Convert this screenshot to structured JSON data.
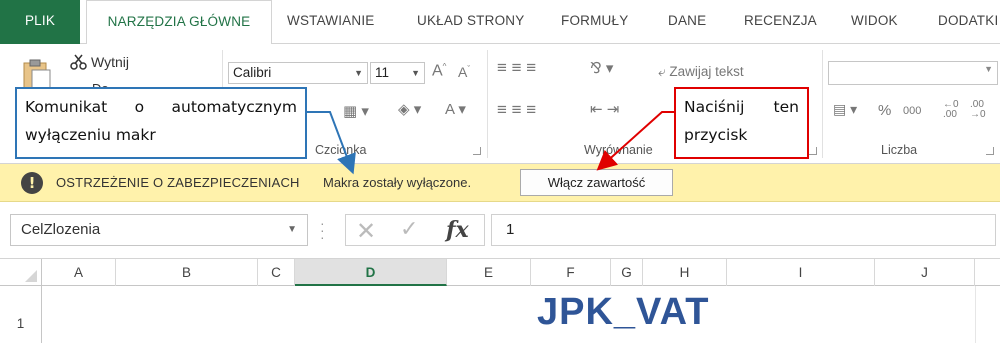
{
  "tabs": {
    "file": "PLIK",
    "home": "NARZĘDZIA GŁÓWNE",
    "insert": "WSTAWIANIE",
    "layout": "UKŁAD STRONY",
    "formulas": "FORMUŁY",
    "data": "DANE",
    "review": "RECENZJA",
    "view": "WIDOK",
    "developer": "DODATKI"
  },
  "ribbon": {
    "clipboard": {
      "cut_label": "Wytnij",
      "copy_label_partial": "Do..."
    },
    "font": {
      "name": "Calibri",
      "size": "11",
      "group_label": "Czcionka"
    },
    "alignment": {
      "wrap_label": "Zawijaj tekst",
      "group_label": "Wyrównanie"
    },
    "number": {
      "group_label": "Liczba",
      "percent": "%",
      "thousands": "000"
    }
  },
  "security_bar": {
    "title": "OSTRZEŻENIE O ZABEZPIECZENIACH",
    "message": "Makra zostały wyłączone.",
    "enable_button": "Włącz zawartość"
  },
  "formula_bar": {
    "name_box": "CelZlozenia",
    "fx": "fx",
    "value": "1"
  },
  "sheet": {
    "columns": [
      "A",
      "B",
      "C",
      "D",
      "E",
      "F",
      "G",
      "H",
      "I",
      "J"
    ],
    "selected_column": "D",
    "row_label": "1",
    "title_text": "JPK_VAT"
  },
  "callouts": {
    "blue_line1": "Komunikat o automatycznym",
    "blue_line2": "wyłączeniu makr",
    "red_line1": "Naciśnij ten",
    "red_line2": "przycisk"
  },
  "colors": {
    "excel_green": "#217346",
    "security_bar_bg": "#fff2ab",
    "callout_blue": "#2e75b6",
    "callout_red": "#e00000",
    "title_blue": "#2f5597"
  }
}
